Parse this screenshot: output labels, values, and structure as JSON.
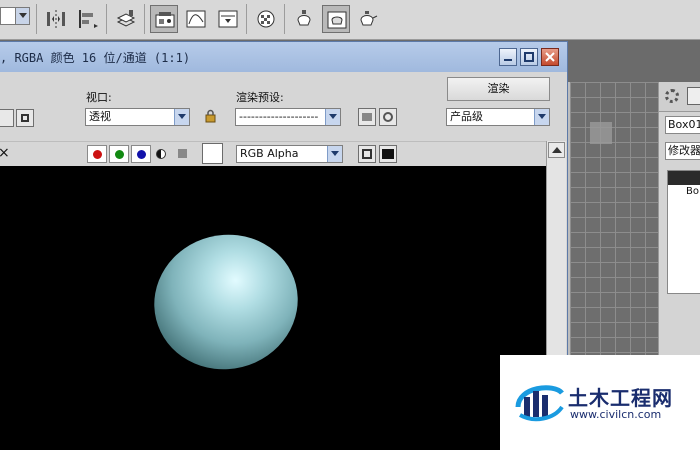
{
  "window": {
    "title": ", RGBA 颜色 16 位/通道 (1:1)"
  },
  "render_frame": {
    "viewport_label": "视口:",
    "viewport_value": "透视",
    "preset_label": "渲染预设:",
    "preset_value": "--------------------",
    "render_button": "渲染",
    "quality_value": "产品级",
    "channel_value": "RGB Alpha",
    "close_glyph": "×",
    "colors": {
      "red_channel": "#cc1111",
      "green_channel": "#128a12",
      "blue_channel": "#1212aa",
      "canvas": "#000000",
      "sphere": "#8fc6cd"
    }
  },
  "command_panel": {
    "object_name": "Box01",
    "modifier_list": "修改器",
    "stack_item": "Bo"
  },
  "watermark": {
    "title": "土木工程网",
    "url": "www.civilcn.com"
  },
  "icons": [
    "mirror-icon",
    "align-icon",
    "layer-icon",
    "render-setup-icon",
    "curve-editor-icon",
    "material-editor-icon",
    "render-frame-icon",
    "teapot-icon",
    "lock-icon",
    "display-icon",
    "gear-icon"
  ]
}
